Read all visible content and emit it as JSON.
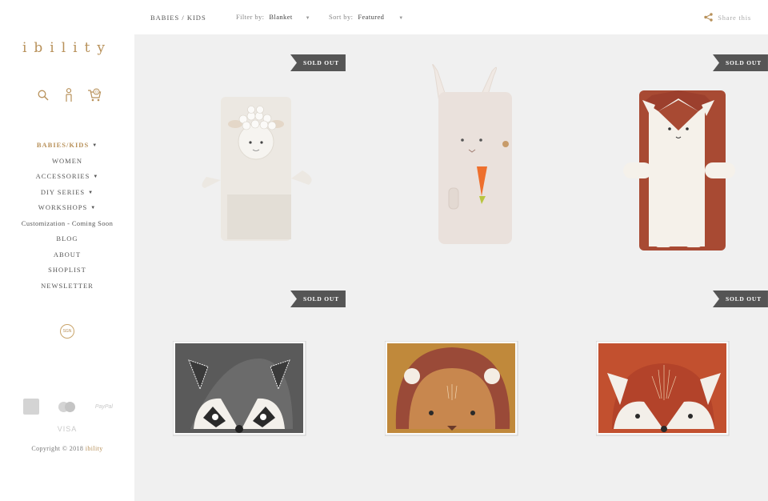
{
  "brand": {
    "logo": "ibility"
  },
  "icons": {
    "search": "search-icon",
    "account": "account-icon",
    "cart": "cart-icon",
    "cart_count": "0"
  },
  "nav": {
    "items": [
      {
        "label": "BABIES/KIDS",
        "dropdown": true
      },
      {
        "label": "WOMEN",
        "dropdown": false
      },
      {
        "label": "ACCESSORIES",
        "dropdown": true
      },
      {
        "label": "DIY SERIES",
        "dropdown": true
      },
      {
        "label": "WORKSHOPS",
        "dropdown": true
      },
      {
        "label": "Customization - Coming Soon",
        "dropdown": false
      },
      {
        "label": "BLOG",
        "dropdown": false
      },
      {
        "label": "ABOUT",
        "dropdown": false
      },
      {
        "label": "SHOPLIST",
        "dropdown": false
      },
      {
        "label": "NEWSLETTER",
        "dropdown": false
      }
    ]
  },
  "social_badge": "SGN",
  "payments": {
    "visa": "VISA",
    "paypal": "PayPal"
  },
  "footer": {
    "copyright_prefix": "Copyright © 2018 ",
    "copyright_brand": "ibility"
  },
  "topbar": {
    "breadcrumb": "BABIES / KIDS",
    "filter_label": "Filter by:",
    "filter_value": "Blanket",
    "sort_label": "Sort by:",
    "sort_value": "Featured",
    "share": "Share this"
  },
  "products": [
    {
      "name": "Sheep blanket",
      "sold_out": true,
      "badge": "SOLD OUT"
    },
    {
      "name": "Bunny blanket",
      "sold_out": false,
      "badge": ""
    },
    {
      "name": "Fox blanket",
      "sold_out": true,
      "badge": "SOLD OUT"
    },
    {
      "name": "Raccoon hooded towel",
      "sold_out": true,
      "badge": "SOLD OUT"
    },
    {
      "name": "Lion hooded towel",
      "sold_out": false,
      "badge": ""
    },
    {
      "name": "Fox hooded towel",
      "sold_out": true,
      "badge": "SOLD OUT"
    }
  ],
  "colors": {
    "accent": "#b8915a",
    "ribbon": "#555555",
    "background": "#f0f0f0"
  }
}
